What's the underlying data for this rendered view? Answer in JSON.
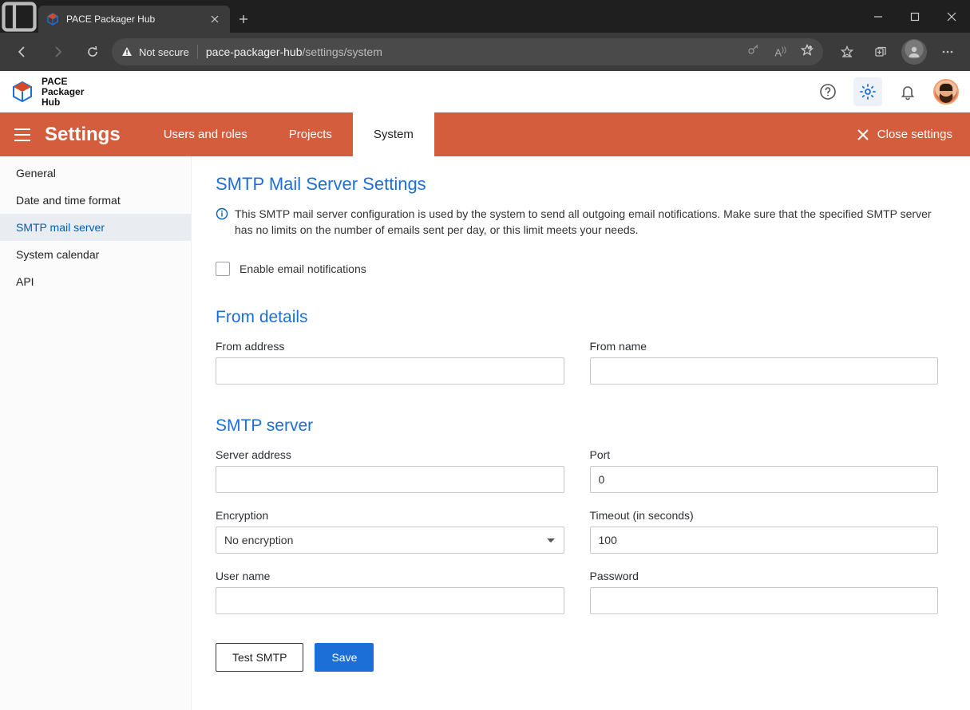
{
  "browser": {
    "tab_title": "PACE Packager Hub",
    "security_label": "Not secure",
    "url_host": "pace-packager-hub",
    "url_path": "/settings/system"
  },
  "app": {
    "brand_line1": "PACE",
    "brand_line2": "Packager",
    "brand_line3": "Hub"
  },
  "ribbon": {
    "title": "Settings",
    "tabs": [
      {
        "label": "Users and roles",
        "active": false
      },
      {
        "label": "Projects",
        "active": false
      },
      {
        "label": "System",
        "active": true
      }
    ],
    "close_label": "Close settings"
  },
  "sidebar": {
    "items": [
      {
        "label": "General",
        "active": false
      },
      {
        "label": "Date and time format",
        "active": false
      },
      {
        "label": "SMTP mail server",
        "active": true
      },
      {
        "label": "System calendar",
        "active": false
      },
      {
        "label": "API",
        "active": false
      }
    ]
  },
  "smtp": {
    "heading": "SMTP Mail Server Settings",
    "info": "This SMTP mail server configuration is used by the system to send all outgoing email notifications. Make sure that the specified SMTP server has no limits on the number of emails sent per day, or this limit meets your needs.",
    "enable_label": "Enable email notifications",
    "from_heading": "From details",
    "from_address_label": "From address",
    "from_address_value": "",
    "from_name_label": "From name",
    "from_name_value": "",
    "server_heading": "SMTP server",
    "server_address_label": "Server address",
    "server_address_value": "",
    "port_label": "Port",
    "port_value": "0",
    "encryption_label": "Encryption",
    "encryption_value": "No encryption",
    "timeout_label": "Timeout (in seconds)",
    "timeout_value": "100",
    "user_label": "User name",
    "user_value": "",
    "password_label": "Password",
    "password_value": "",
    "test_btn": "Test SMTP",
    "save_btn": "Save"
  }
}
